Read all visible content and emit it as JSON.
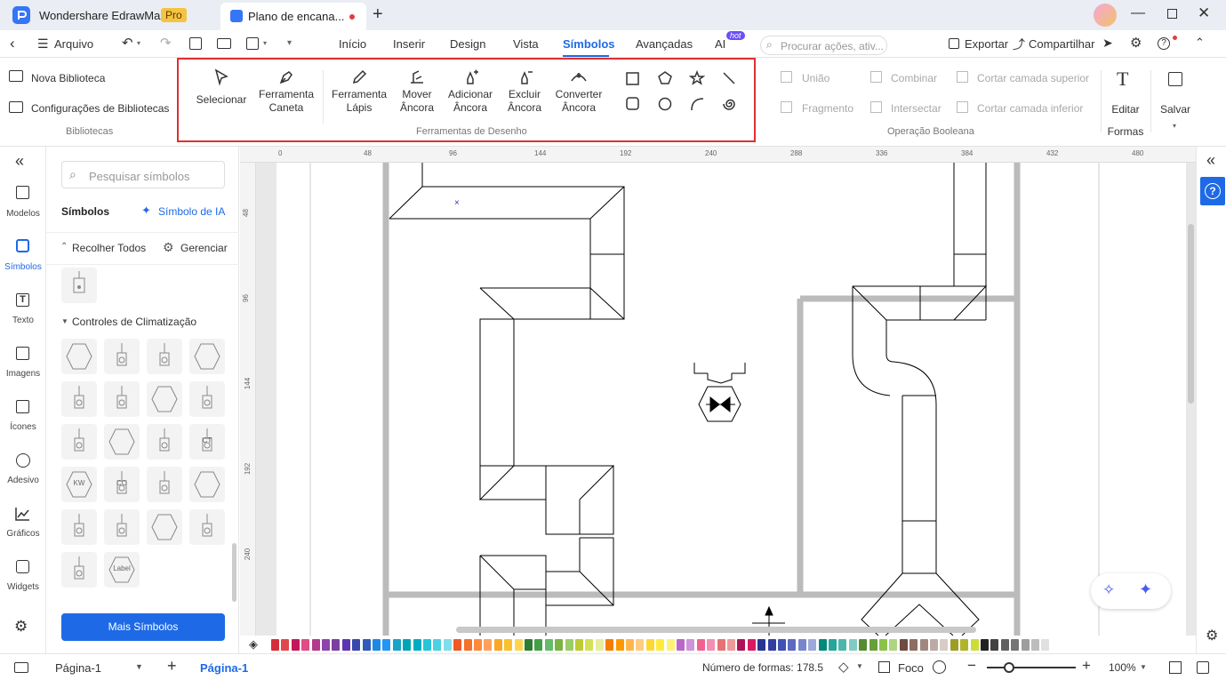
{
  "app": {
    "name": "Wondershare EdrawMax",
    "badge": "Pro"
  },
  "tab": {
    "title": "Plano de encana..."
  },
  "menu": {
    "file": "Arquivo",
    "items": [
      "Início",
      "Inserir",
      "Design",
      "Vista",
      "Símbolos",
      "Avançadas",
      "AI"
    ],
    "active": "Símbolos",
    "ai_badge": "hot",
    "search_placeholder": "Procurar ações, ativ...",
    "export": "Exportar",
    "share": "Compartilhar"
  },
  "ribbon": {
    "libraries": {
      "new": "Nova Biblioteca",
      "settings": "Configurações de Bibliotecas",
      "group": "Bibliotecas"
    },
    "drawing": {
      "select": "Selecionar",
      "pen_1": "Ferramenta",
      "pen_2": "Caneta",
      "pencil_1": "Ferramenta",
      "pencil_2": "Lápis",
      "move_1": "Mover",
      "move_2": "Âncora",
      "add_1": "Adicionar",
      "add_2": "Âncora",
      "del_1": "Excluir",
      "del_2": "Âncora",
      "conv_1": "Converter",
      "conv_2": "Âncora",
      "group": "Ferramentas de Desenho"
    },
    "boolean": {
      "union": "União",
      "combine": "Combinar",
      "cut_top": "Cortar camada superior",
      "fragment": "Fragmento",
      "intersect": "Intersectar",
      "cut_bottom": "Cortar camada inferior",
      "group": "Operação Booleana"
    },
    "edit": "Editar",
    "save": "Salvar",
    "shapes": "Formas"
  },
  "leftnav": [
    "Modelos",
    "Símbolos",
    "Texto",
    "Imagens",
    "Ícones",
    "Adesivo",
    "Gráficos",
    "Widgets"
  ],
  "library": {
    "search_placeholder": "Pesquisar símbolos",
    "title": "Símbolos",
    "ai_symbol": "Símbolo de IA",
    "collapse": "Recolher Todos",
    "manage": "Gerenciar",
    "category": "Controles de Climatização",
    "tiles": [
      "",
      "",
      "",
      "",
      "",
      "",
      "",
      "",
      "",
      "",
      "",
      "CT",
      "KW",
      "CO",
      "",
      "",
      "",
      "",
      "",
      "",
      "",
      "Label"
    ],
    "more": "Mais Símbolos"
  },
  "ruler": {
    "top": [
      "0",
      "48",
      "96",
      "144",
      "192",
      "240",
      "288",
      "336",
      "384",
      "432",
      "480"
    ],
    "left": [
      "48",
      "96",
      "144",
      "192",
      "240"
    ]
  },
  "palette": [
    "#d62d3a",
    "#e0474c",
    "#c2185b",
    "#e04d86",
    "#b23a8b",
    "#8e44ad",
    "#7b3fa0",
    "#5e35b1",
    "#3949ab",
    "#2e5cb8",
    "#1e88e5",
    "#2196f3",
    "#1aa3c8",
    "#00a5b5",
    "#00acc1",
    "#26c6da",
    "#4dd0e1",
    "#80deea",
    "#ef5a24",
    "#f4722b",
    "#ff8a3d",
    "#ffa05c",
    "#f9a825",
    "#fbc02d",
    "#ffd54f",
    "#2e7d32",
    "#43a047",
    "#66bb6a",
    "#7cb342",
    "#9ccc65",
    "#c0ca33",
    "#d4e157",
    "#e6ee9c",
    "#f57c00",
    "#ff9800",
    "#ffb74d",
    "#ffcc80",
    "#fdd835",
    "#ffeb3b",
    "#fff176",
    "#ba68c8",
    "#ce93d8",
    "#f06292",
    "#f48fb1",
    "#e57373",
    "#ef9a9a",
    "#ad1457",
    "#d81b60",
    "#283593",
    "#303f9f",
    "#3f51b5",
    "#5c6bc0",
    "#7986cb",
    "#9fa8da",
    "#00897b",
    "#26a69a",
    "#4db6ac",
    "#80cbc4",
    "#558b2f",
    "#689f38",
    "#8bc34a",
    "#aed581",
    "#6d4c41",
    "#8d6e63",
    "#a1887f",
    "#bcaaa4",
    "#d7ccc8",
    "#9e9d24",
    "#afb42b",
    "#cddc39",
    "#212121",
    "#424242",
    "#616161",
    "#757575",
    "#9e9e9e",
    "#bdbdbd",
    "#e0e0e0"
  ],
  "status": {
    "page_selector": "Página-1",
    "page_tab": "Página-1",
    "shape_count": "Número de formas: 178.5",
    "focus": "Foco",
    "zoom": "100%"
  }
}
